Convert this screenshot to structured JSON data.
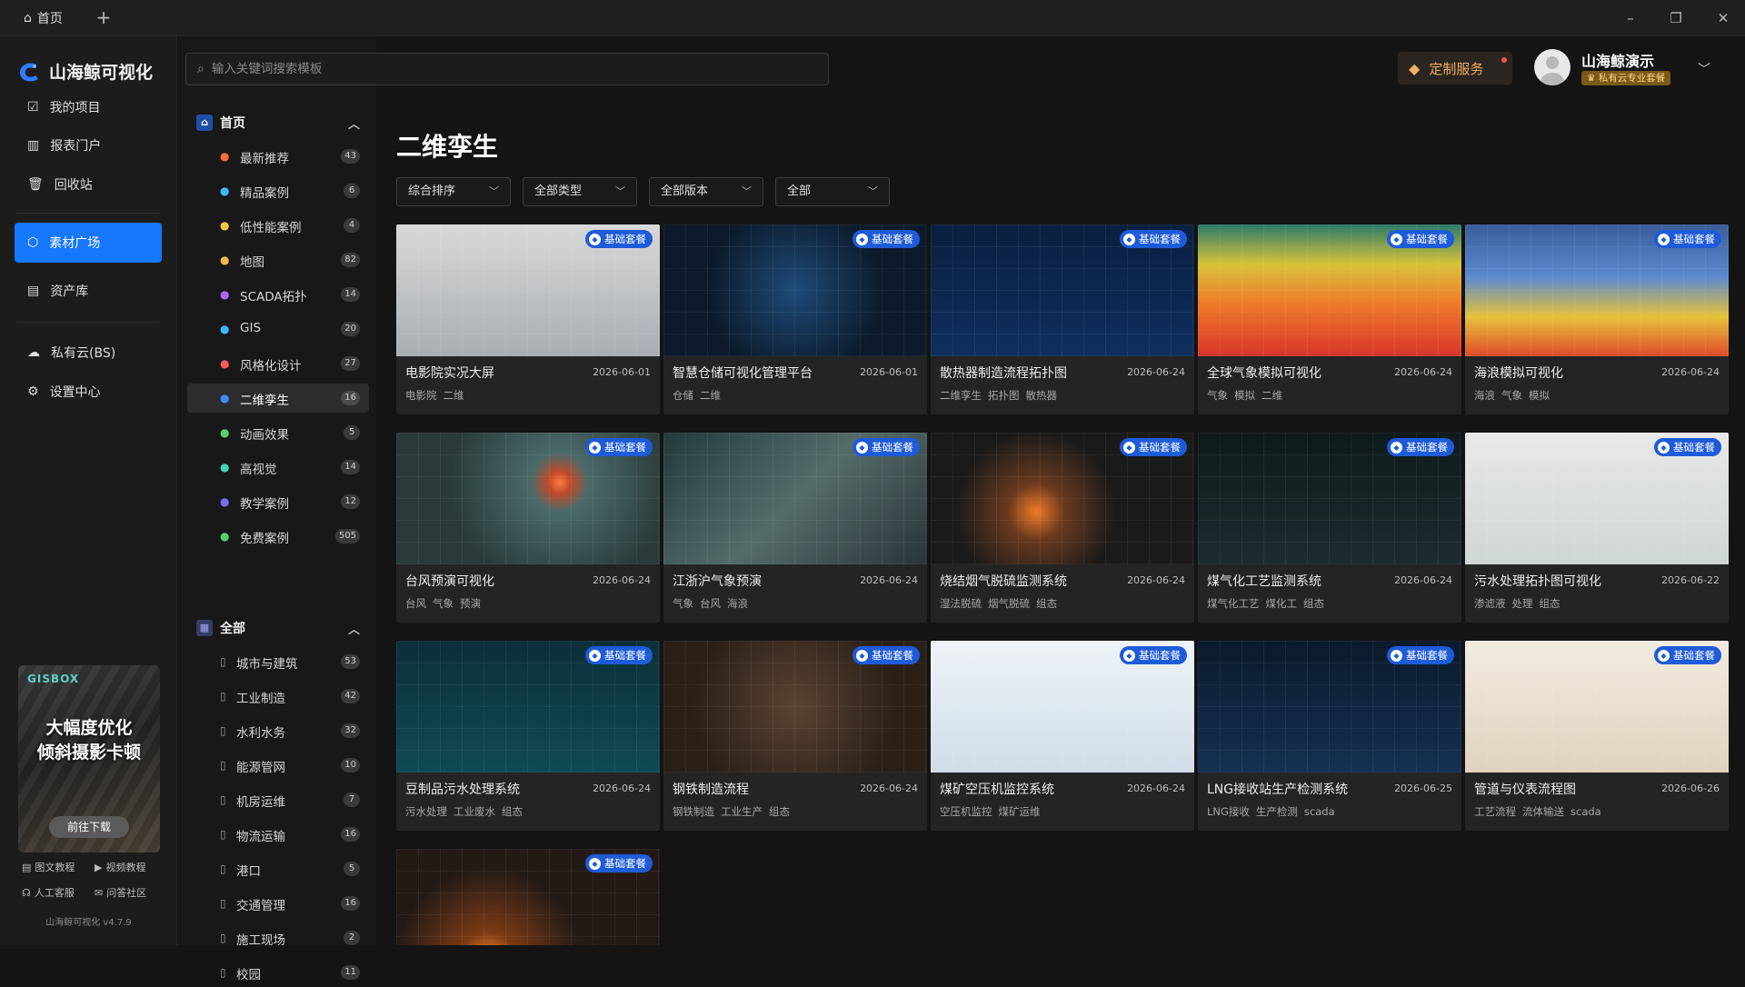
{
  "titlebar": {
    "tab_label": "首页",
    "add_tab": "+"
  },
  "window": {
    "minimize": "–",
    "restore": "❐",
    "close": "✕"
  },
  "brand": {
    "name": "山海鲸可视化"
  },
  "nav": {
    "items": [
      "我的项目",
      "报表门户",
      "回收站",
      "素材广场",
      "资产库",
      "私有云(BS)",
      "设置中心"
    ],
    "active": "素材广场",
    "accent": "#1677ff"
  },
  "promo": {
    "brand": "GISBOX",
    "line1": "大幅度优化",
    "line2": "倾斜摄影卡顿",
    "button": "前往下载"
  },
  "help": {
    "docs": "图文教程",
    "video": "视频教程",
    "support": "人工客服",
    "community": "问答社区"
  },
  "version": "山海鲸可视化 v4.7.9",
  "search": {
    "placeholder": "输入关键词搜索模板"
  },
  "header": {
    "custom_service": "定制服务",
    "username": "山海鲸演示",
    "user_badge": "私有云专业套餐"
  },
  "categories": {
    "home_title": "首页",
    "home_items": [
      {
        "label": "最新推荐",
        "count": "43",
        "color": "#ff6a3d",
        "icon": "fire-icon"
      },
      {
        "label": "精品案例",
        "count": "6",
        "color": "#3db8ff",
        "icon": "case-icon"
      },
      {
        "label": "低性能案例",
        "count": "4",
        "color": "#f5c542",
        "icon": "gauge-icon"
      },
      {
        "label": "地图",
        "count": "82",
        "color": "#f2b84b",
        "icon": "map-icon"
      },
      {
        "label": "SCADA拓扑",
        "count": "14",
        "color": "#a86bff",
        "icon": "cube-icon"
      },
      {
        "label": "GIS",
        "count": "20",
        "color": "#3db8ff",
        "icon": "globe-icon"
      },
      {
        "label": "风格化设计",
        "count": "27",
        "color": "#ff5a5a",
        "icon": "palette-icon"
      },
      {
        "label": "二维孪生",
        "count": "16",
        "color": "#3d8bff",
        "icon": "twin-icon"
      },
      {
        "label": "动画效果",
        "count": "5",
        "color": "#54d16a",
        "icon": "star-icon"
      },
      {
        "label": "高视觉",
        "count": "14",
        "color": "#3dd6b5",
        "icon": "eye-icon"
      },
      {
        "label": "教学案例",
        "count": "12",
        "color": "#7b6bff",
        "icon": "book-icon"
      },
      {
        "label": "免费案例",
        "count": "505",
        "color": "#54d16a",
        "icon": "gift-icon"
      }
    ],
    "active": "二维孪生",
    "all_title": "全部",
    "all_items": [
      {
        "label": "城市与建筑",
        "count": "53"
      },
      {
        "label": "工业制造",
        "count": "42"
      },
      {
        "label": "水利水务",
        "count": "32"
      },
      {
        "label": "能源管网",
        "count": "10"
      },
      {
        "label": "机房运维",
        "count": "7"
      },
      {
        "label": "物流运输",
        "count": "16"
      },
      {
        "label": "港口",
        "count": "5"
      },
      {
        "label": "交通管理",
        "count": "16"
      },
      {
        "label": "施工现场",
        "count": "2"
      },
      {
        "label": "校园",
        "count": "11"
      }
    ]
  },
  "main": {
    "title": "二维孪生",
    "filters": [
      "综合排序",
      "全部类型",
      "全部版本",
      "全部"
    ]
  },
  "cards": [
    {
      "title": "电影院实况大屏",
      "date": "2026-06-01",
      "tags": [
        "电影院",
        "二维"
      ],
      "badge": "基础套餐",
      "style": "light"
    },
    {
      "title": "智慧仓储可视化管理平台",
      "date": "2026-06-01",
      "tags": [
        "仓储",
        "二维"
      ],
      "badge": "基础套餐",
      "style": "warehouse"
    },
    {
      "title": "散热器制造流程拓扑图",
      "date": "2026-06-24",
      "tags": [
        "二维孪生",
        "拓扑图",
        "散热器"
      ],
      "badge": "基础套餐",
      "style": "iso-blue"
    },
    {
      "title": "全球气象模拟可视化",
      "date": "2026-06-24",
      "tags": [
        "气象",
        "模拟",
        "二维"
      ],
      "badge": "基础套餐",
      "style": "heat"
    },
    {
      "title": "海浪模拟可视化",
      "date": "2026-06-24",
      "tags": [
        "海浪",
        "气象",
        "模拟"
      ],
      "badge": "基础套餐",
      "style": "sea"
    },
    {
      "title": "台风预演可视化",
      "date": "2026-06-24",
      "tags": [
        "台风",
        "气象",
        "预演"
      ],
      "badge": "基础套餐",
      "style": "typhoon"
    },
    {
      "title": "江浙沪气象预演",
      "date": "2026-06-24",
      "tags": [
        "气象",
        "台风",
        "海浪"
      ],
      "badge": "基础套餐",
      "style": "storm"
    },
    {
      "title": "烧结烟气脱硫监测系统",
      "date": "2026-06-24",
      "tags": [
        "湿法脱硫",
        "烟气脱硫",
        "组态"
      ],
      "badge": "基础套餐",
      "style": "plant"
    },
    {
      "title": "煤气化工艺监测系统",
      "date": "2026-06-24",
      "tags": [
        "煤气化工艺",
        "煤化工",
        "组态"
      ],
      "badge": "基础套餐",
      "style": "plant2"
    },
    {
      "title": "污水处理拓扑图可视化",
      "date": "2026-06-22",
      "tags": [
        "渗滤液",
        "处理",
        "组态"
      ],
      "badge": "基础套餐",
      "style": "water"
    },
    {
      "title": "豆制品污水处理系统",
      "date": "2026-06-24",
      "tags": [
        "污水处理",
        "工业废水",
        "组态"
      ],
      "badge": "基础套餐",
      "style": "teal"
    },
    {
      "title": "钢铁制造流程",
      "date": "2026-06-24",
      "tags": [
        "钢铁制造",
        "工业生产",
        "组态"
      ],
      "badge": "基础套餐",
      "style": "steel"
    },
    {
      "title": "煤矿空压机监控系统",
      "date": "2026-06-24",
      "tags": [
        "空压机监控",
        "煤矿运维"
      ],
      "badge": "基础套餐",
      "style": "compressor"
    },
    {
      "title": "LNG接收站生产检测系统",
      "date": "2026-06-25",
      "tags": [
        "LNG接收",
        "生产检测",
        "scada"
      ],
      "badge": "基础套餐",
      "style": "lng"
    },
    {
      "title": "管道与仪表流程图",
      "date": "2026-06-26",
      "tags": [
        "工艺流程",
        "流体输送",
        "scada"
      ],
      "badge": "基础套餐",
      "style": "pipe"
    },
    {
      "title": "",
      "date": "",
      "tags": [],
      "badge": "基础套餐",
      "style": "furnace"
    }
  ]
}
